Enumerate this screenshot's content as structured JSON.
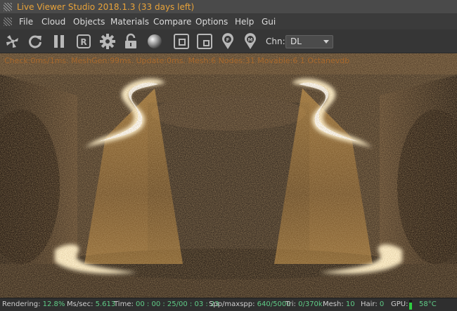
{
  "window": {
    "title": "Live Viewer Studio 2018.1.3 (33 days left)"
  },
  "menu": {
    "items": [
      "File",
      "Cloud",
      "Objects",
      "Materials",
      "Compare",
      "Options",
      "Help",
      "Gui"
    ]
  },
  "toolbar": {
    "icons": [
      "send-scene-icon",
      "restart-render-icon",
      "pause-render-icon",
      "region-render-icon",
      "settings-gear-icon",
      "lock-icon",
      "material-sphere-icon",
      "film-region-icon",
      "film-region-alt-icon",
      "focus-pick-icon",
      "material-pick-icon"
    ],
    "channel_label": "Chn:",
    "channel_value": "DL"
  },
  "viewport": {
    "info_text": "Check:0ms/1ms. MeshGen:99ms. Update:0ms. Mesh:6 Nodes:31 Movable:6 1 Octanevdb",
    "accent_color": "#e8a33a"
  },
  "status": {
    "rendering_label": "Rendering:",
    "rendering_value": "12.8%",
    "ms_label": "Ms/sec:",
    "ms_value": "5.613",
    "time_label": "Time:",
    "time_value": "00 : 00 : 25/00 : 03 : 23",
    "spp_label": "Spp/maxspp:",
    "spp_value": "640/5000",
    "tri_label": "Tri:",
    "tri_value": "0/370k",
    "mesh_label": "Mesh:",
    "mesh_value": "10",
    "hair_label": "Hair:",
    "hair_value": "0",
    "gpu_label": "GPU:",
    "gpu_level": 0.75,
    "gpu_temp": "58°C"
  }
}
